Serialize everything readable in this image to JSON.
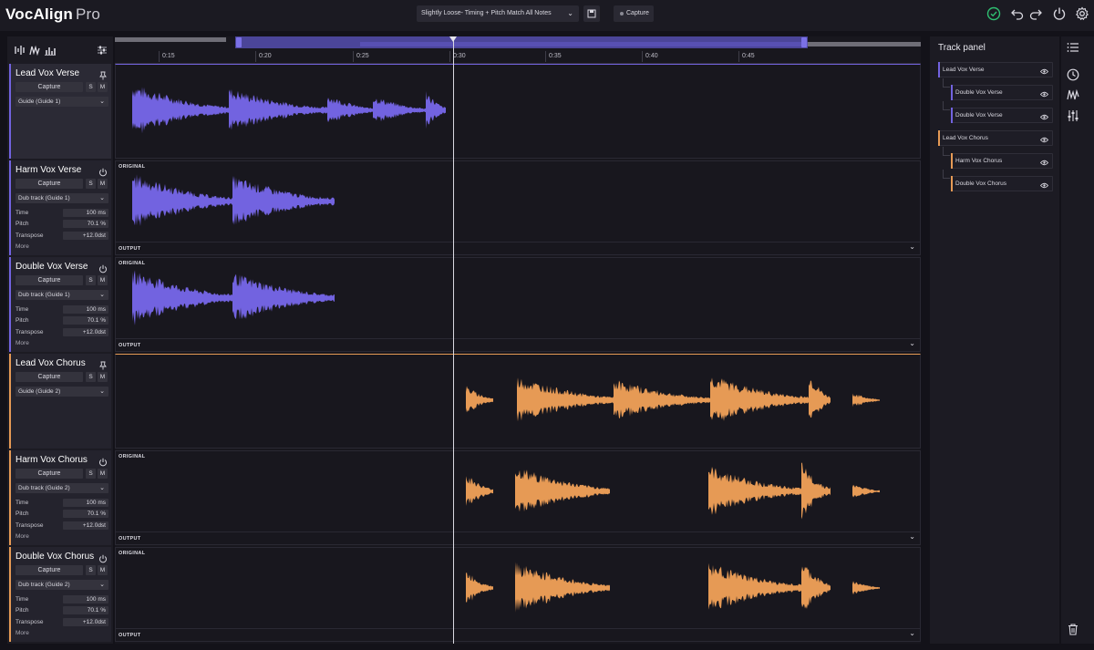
{
  "app": {
    "name": "VocAlign",
    "edition": "Pro",
    "preset": "Slightly Loose- Timing + Pitch Match All Notes",
    "capture_label": "Capture"
  },
  "colors": {
    "guide1": "#7263e0",
    "guide2": "#e69a55",
    "accent_ok": "#2fbf71"
  },
  "icons": [
    "waveform-tool-icon",
    "pitch-tool-icon",
    "bars-tool-icon",
    "settings-sliders-icon",
    "save-icon",
    "check-circle-icon",
    "undo-icon",
    "redo-icon",
    "power-icon",
    "gear-icon",
    "list-icon",
    "clock-icon",
    "waveform-icon",
    "mixer-icon",
    "trash-icon",
    "eye-icon",
    "pin-icon"
  ],
  "ruler": {
    "ticks": [
      "0:15",
      "0:20",
      "0:25",
      "0:30",
      "0:35",
      "0:40",
      "0:45"
    ]
  },
  "tracks": [
    {
      "name": "Lead Vox Verse",
      "role": "guide",
      "capture": "Capture",
      "s": "S",
      "m": "M",
      "guide": "Guide (Guide 1)"
    },
    {
      "name": "Harm Vox Verse",
      "role": "dub",
      "capture": "Capture",
      "s": "S",
      "m": "M",
      "guide": "Dub track (Guide 1)",
      "params": {
        "time_label": "Time",
        "time": "100 ms",
        "pitch_label": "Pitch",
        "pitch": "70.1 %",
        "transpose_label": "Transpose",
        "transpose": "+12.0dst"
      },
      "more": "More"
    },
    {
      "name": "Double Vox Verse",
      "role": "dub",
      "capture": "Capture",
      "s": "S",
      "m": "M",
      "guide": "Dub track (Guide 1)",
      "params": {
        "time_label": "Time",
        "time": "100 ms",
        "pitch_label": "Pitch",
        "pitch": "70.1 %",
        "transpose_label": "Transpose",
        "transpose": "+12.0dst"
      },
      "more": "More"
    },
    {
      "name": "Lead Vox Chorus",
      "role": "guide",
      "capture": "Capture",
      "s": "S",
      "m": "M",
      "guide": "Guide (Guide 2)"
    },
    {
      "name": "Harm Vox Chorus",
      "role": "dub",
      "capture": "Capture",
      "s": "S",
      "m": "M",
      "guide": "Dub track (Guide 2)",
      "params": {
        "time_label": "Time",
        "time": "100 ms",
        "pitch_label": "Pitch",
        "pitch": "70.1 %",
        "transpose_label": "Transpose",
        "transpose": "+12.0dst"
      },
      "more": "More"
    },
    {
      "name": "Double Vox Chorus",
      "role": "dub",
      "capture": "Capture",
      "s": "S",
      "m": "M",
      "guide": "Dub track (Guide 2)",
      "params": {
        "time_label": "Time",
        "time": "100 ms",
        "pitch_label": "Pitch",
        "pitch": "70.1 %",
        "transpose_label": "Transpose",
        "transpose": "+12.0dst"
      },
      "more": "More"
    }
  ],
  "lanes": {
    "original_label": "ORIGINAL",
    "output_label": "OUTPUT"
  },
  "track_panel": {
    "title": "Track panel",
    "items": [
      {
        "label": "Lead Vox Verse",
        "level": 0,
        "group": "guide1"
      },
      {
        "label": "Double Vox Verse",
        "level": 1,
        "group": "guide1"
      },
      {
        "label": "Double Vox Verse",
        "level": 1,
        "group": "guide1"
      },
      {
        "label": "Lead Vox Chorus",
        "level": 0,
        "group": "guide2"
      },
      {
        "label": "Harm Vox Chorus",
        "level": 1,
        "group": "guide2"
      },
      {
        "label": "Double Vox Chorus",
        "level": 1,
        "group": "guide2"
      }
    ]
  }
}
